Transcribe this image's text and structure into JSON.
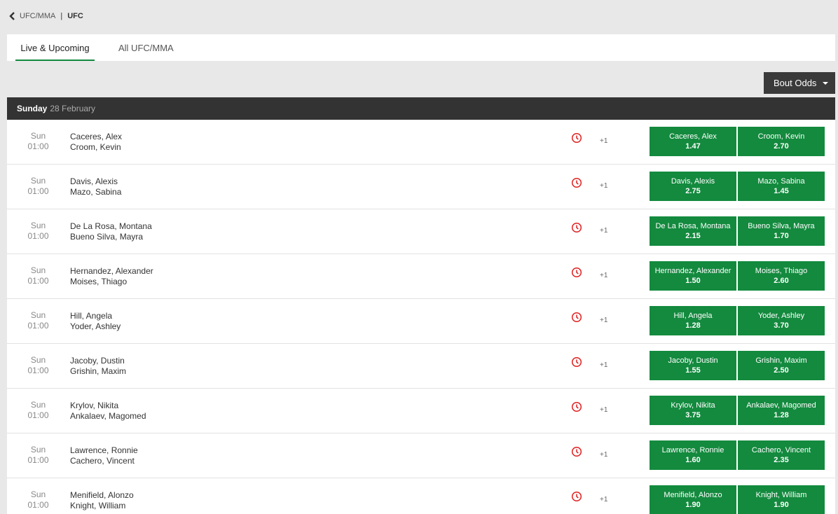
{
  "breadcrumb": {
    "parent": "UFC/MMA",
    "separator": "|",
    "current": "UFC"
  },
  "tabs": [
    {
      "label": "Live & Upcoming",
      "active": true
    },
    {
      "label": "All UFC/MMA",
      "active": false
    }
  ],
  "market_select": {
    "label": "Bout Odds"
  },
  "day_header": {
    "day": "Sunday",
    "date": "28 February"
  },
  "colors": {
    "accent": "#138a3e",
    "header_bg": "#333333",
    "clock": "#e02020"
  },
  "events": [
    {
      "day": "Sun",
      "time": "01:00",
      "fighter1": "Caceres, Alex",
      "fighter2": "Croom, Kevin",
      "more": "+1",
      "odd1": "1.47",
      "odd2": "2.70"
    },
    {
      "day": "Sun",
      "time": "01:00",
      "fighter1": "Davis, Alexis",
      "fighter2": "Mazo, Sabina",
      "more": "+1",
      "odd1": "2.75",
      "odd2": "1.45"
    },
    {
      "day": "Sun",
      "time": "01:00",
      "fighter1": "De La Rosa, Montana",
      "fighter2": "Bueno Silva, Mayra",
      "more": "+1",
      "odd1": "2.15",
      "odd2": "1.70"
    },
    {
      "day": "Sun",
      "time": "01:00",
      "fighter1": "Hernandez, Alexander",
      "fighter2": "Moises, Thiago",
      "more": "+1",
      "odd1": "1.50",
      "odd2": "2.60"
    },
    {
      "day": "Sun",
      "time": "01:00",
      "fighter1": "Hill, Angela",
      "fighter2": "Yoder, Ashley",
      "more": "+1",
      "odd1": "1.28",
      "odd2": "3.70"
    },
    {
      "day": "Sun",
      "time": "01:00",
      "fighter1": "Jacoby, Dustin",
      "fighter2": "Grishin, Maxim",
      "more": "+1",
      "odd1": "1.55",
      "odd2": "2.50"
    },
    {
      "day": "Sun",
      "time": "01:00",
      "fighter1": "Krylov, Nikita",
      "fighter2": "Ankalaev, Magomed",
      "more": "+1",
      "odd1": "3.75",
      "odd2": "1.28"
    },
    {
      "day": "Sun",
      "time": "01:00",
      "fighter1": "Lawrence, Ronnie",
      "fighter2": "Cachero, Vincent",
      "more": "+1",
      "odd1": "1.60",
      "odd2": "2.35"
    },
    {
      "day": "Sun",
      "time": "01:00",
      "fighter1": "Menifield, Alonzo",
      "fighter2": "Knight, William",
      "more": "+1",
      "odd1": "1.90",
      "odd2": "1.90"
    }
  ]
}
